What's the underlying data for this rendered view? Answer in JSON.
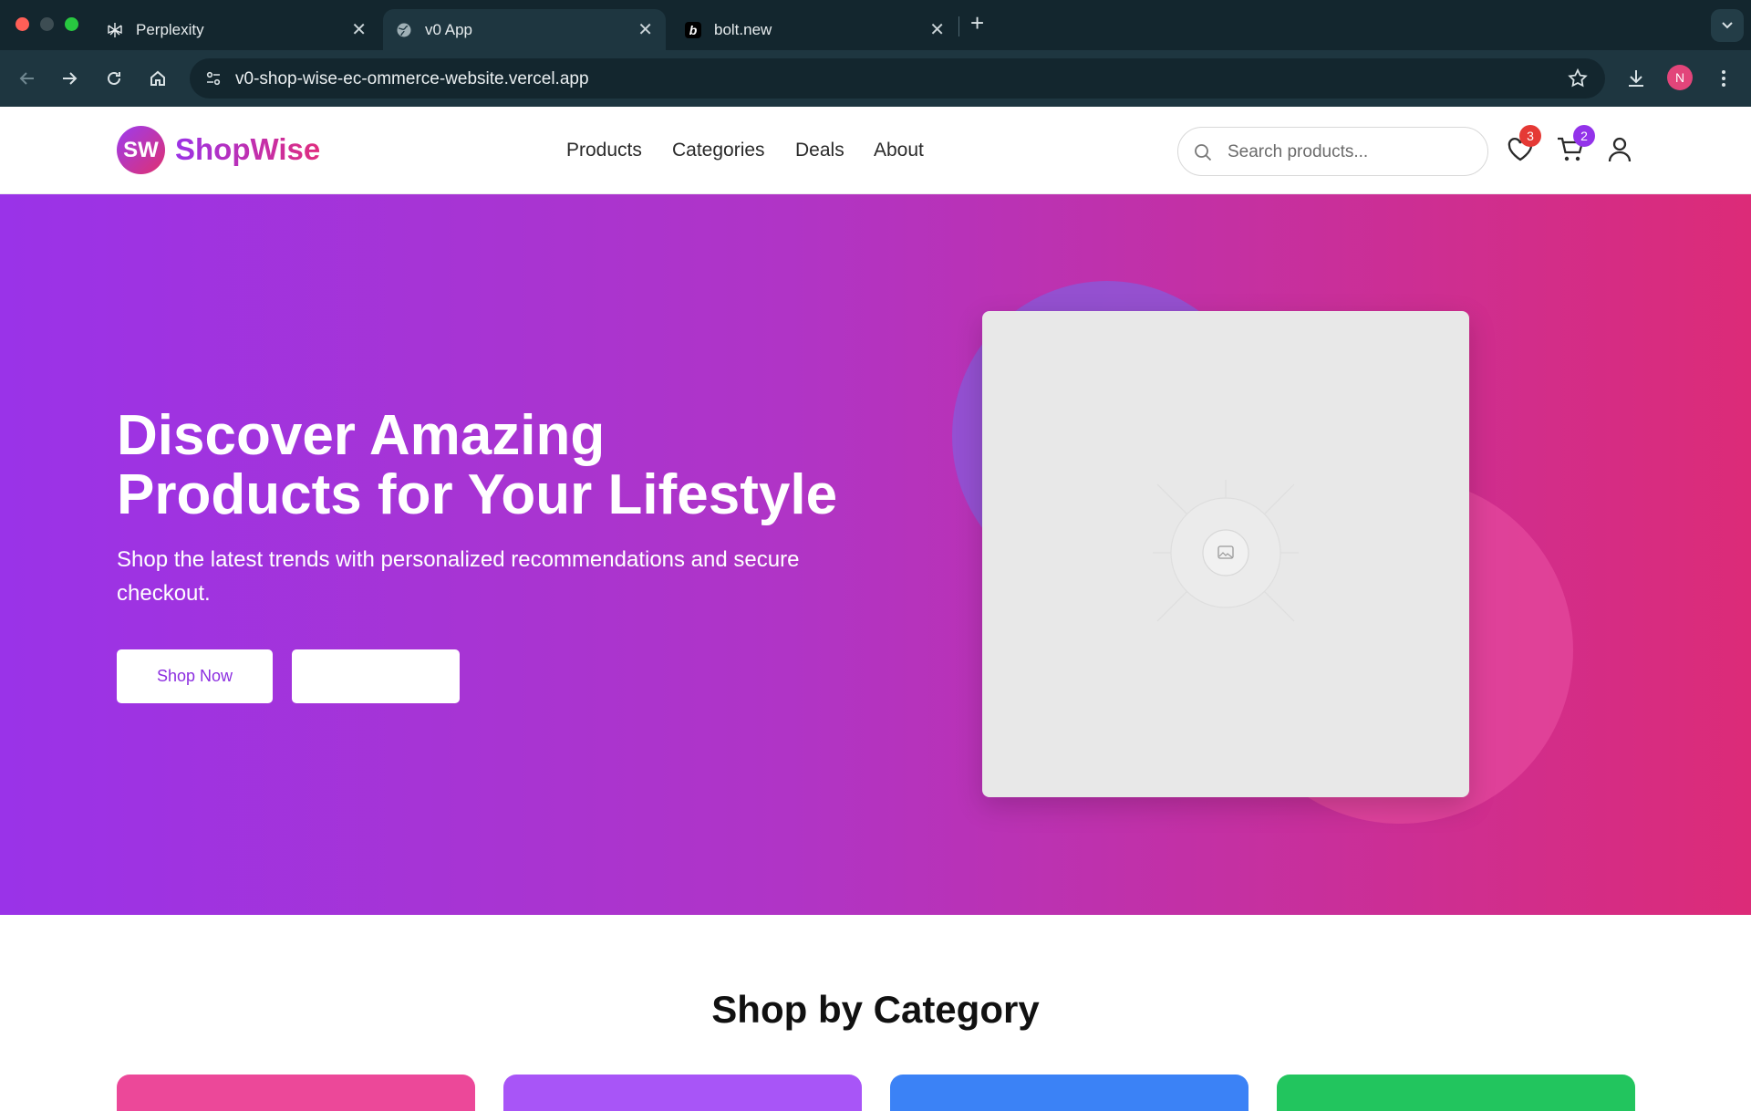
{
  "browser": {
    "tabs": [
      {
        "title": "Perplexity",
        "active": false
      },
      {
        "title": "v0 App",
        "active": true
      },
      {
        "title": "bolt.new",
        "active": false
      }
    ],
    "url": "v0-shop-wise-ec-ommerce-website.vercel.app",
    "profile_initial": "N"
  },
  "header": {
    "logo_initials": "SW",
    "brand": "ShopWise",
    "nav": [
      "Products",
      "Categories",
      "Deals",
      "About"
    ],
    "search_placeholder": "Search products...",
    "wishlist_count": "3",
    "cart_count": "2"
  },
  "hero": {
    "title_line1": "Discover Amazing",
    "title_line2": "Products for Your Lifestyle",
    "subtitle": "Shop the latest trends with personalized recommendations and secure checkout.",
    "primary_button": "Shop Now",
    "secondary_button": ""
  },
  "categories": {
    "heading": "Shop by Category",
    "card_colors": [
      "#ec4899",
      "#a855f7",
      "#3b82f6",
      "#22c55e"
    ]
  },
  "colors": {
    "brand_start": "#9b32e6",
    "brand_end": "#e02d7e",
    "wishlist_badge": "#e53935",
    "cart_badge": "#9333ea"
  }
}
